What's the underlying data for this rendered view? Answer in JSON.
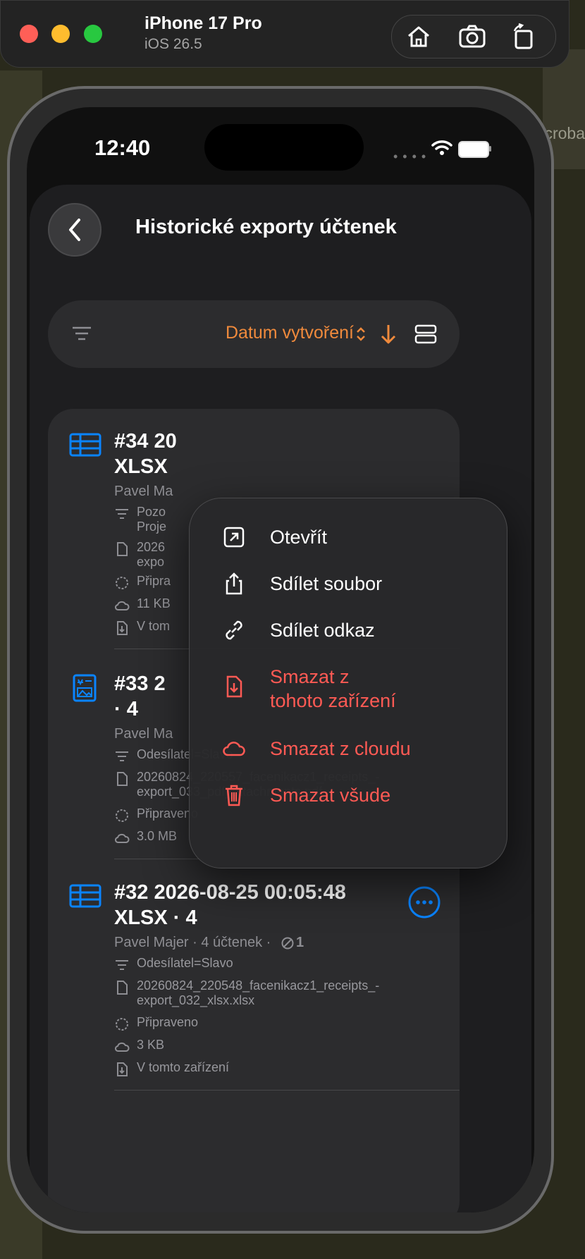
{
  "simulator": {
    "device_name": "iPhone 17 Pro",
    "os_version": "iOS 26.5",
    "background_peek_text": "croba"
  },
  "status_bar": {
    "time": "12:40"
  },
  "nav": {
    "title": "Historické exporty účtenek"
  },
  "toolbar": {
    "sort_label": "Datum vytvoření"
  },
  "items": [
    {
      "title_line1": "#34 20",
      "title_line2": "XLSX",
      "meta": "Pavel Ma",
      "details": [
        {
          "icon": "filter-icon",
          "text": "Pozo",
          "text2": "Proje"
        },
        {
          "icon": "document-icon",
          "text": "2026",
          "text2": "expo"
        },
        {
          "icon": "status-circle-icon",
          "text": "Připra"
        },
        {
          "icon": "cloud-icon",
          "text": "11 KB"
        },
        {
          "icon": "download-icon",
          "text": "V tom"
        }
      ]
    },
    {
      "title_line1": "#33 2",
      "title_line2": "· 4",
      "meta": "Pavel Ma",
      "details": [
        {
          "icon": "filter-icon",
          "text": "Odesílatel=Slavo"
        },
        {
          "icon": "document-icon",
          "text": "20260824_220557_facenikacz1_receipts_-",
          "text2": "export_033_pdf_attachments.pdf"
        },
        {
          "icon": "status-circle-icon",
          "text": "Připraveno"
        },
        {
          "icon": "cloud-icon",
          "text": "3.0 MB"
        }
      ]
    },
    {
      "title_line1": "#32 2026-08-25 00:05:48",
      "title_line2": "XLSX · 4",
      "meta": "Pavel Majer · 4 účtenek  · ",
      "meta_count": "1",
      "details": [
        {
          "icon": "filter-icon",
          "text": "Odesílatel=Slavo"
        },
        {
          "icon": "document-icon",
          "text": "20260824_220548_facenikacz1_receipts_-",
          "text2": "export_032_xlsx.xlsx"
        },
        {
          "icon": "status-circle-icon",
          "text": "Připraveno"
        },
        {
          "icon": "cloud-icon",
          "text": "3 KB"
        },
        {
          "icon": "download-icon",
          "text": "V tomto zařízení"
        }
      ]
    }
  ],
  "context_menu": {
    "items": [
      {
        "label": "Otevřít",
        "icon": "open-external-icon",
        "danger": false
      },
      {
        "label": "Sdílet soubor",
        "icon": "share-icon",
        "danger": false
      },
      {
        "label": "Sdílet odkaz",
        "icon": "link-icon",
        "danger": false
      },
      {
        "label": "Smazat z",
        "label2": "tohoto zařízení",
        "icon": "delete-local-file-icon",
        "danger": true
      },
      {
        "label": "Smazat z cloudu",
        "icon": "cloud-delete-icon",
        "danger": true
      },
      {
        "label": "Smazat všude",
        "icon": "trash-icon",
        "danger": true
      }
    ]
  },
  "colors": {
    "accent_orange": "#f08a3c",
    "accent_blue": "#0a84ff",
    "danger_red": "#ff5a54"
  }
}
